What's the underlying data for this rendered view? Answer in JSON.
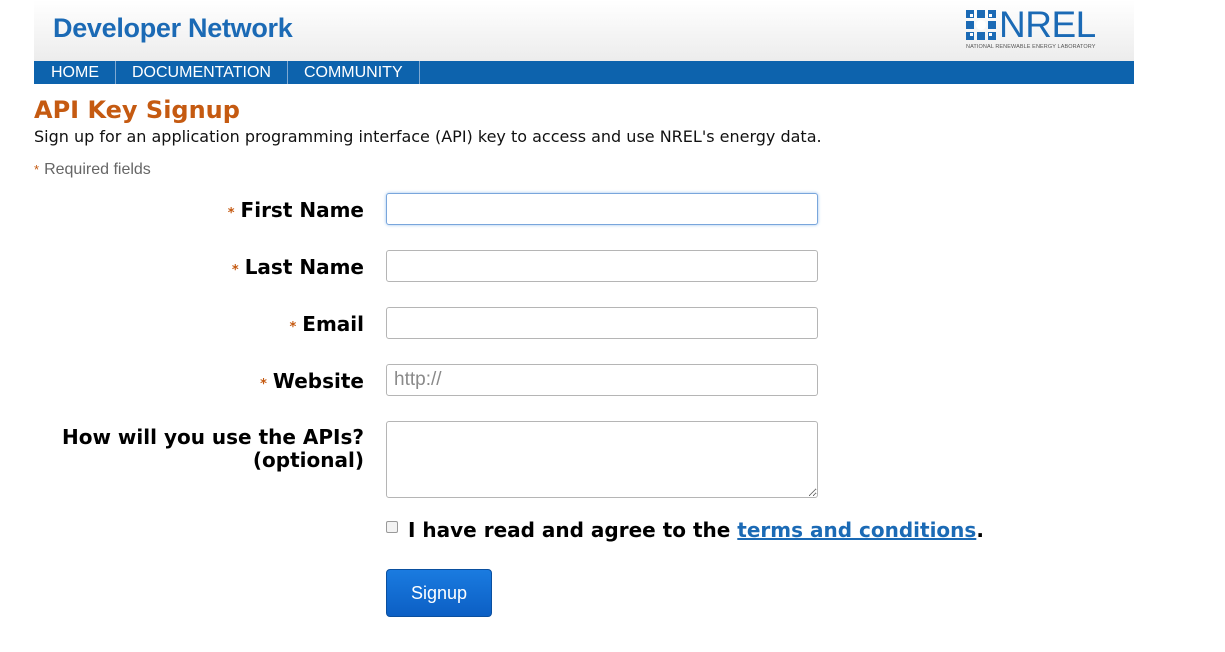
{
  "header": {
    "brand": "Developer Network",
    "logo_text": "NREL",
    "logo_subtext": "NATIONAL RENEWABLE ENERGY LABORATORY",
    "brand_color": "#1b6ab5"
  },
  "nav": {
    "items": [
      "HOME",
      "DOCUMENTATION",
      "COMMUNITY"
    ],
    "background": "#0d63ad"
  },
  "page": {
    "title": "API Key Signup",
    "intro": "Sign up for an application programming interface (API) key to access and use NREL's energy data.",
    "required_marker": "*",
    "required_note": "Required fields",
    "accent_color": "#c55a11"
  },
  "form": {
    "first_name_label": "First Name",
    "first_name_value": "",
    "last_name_label": "Last Name",
    "last_name_value": "",
    "email_label": "Email",
    "email_value": "",
    "website_label": "Website",
    "website_placeholder": "http://",
    "usage_label_line1": "How will you use the APIs?",
    "usage_label_line2": "(optional)",
    "usage_value": "",
    "agree_text": "I have read and agree to the",
    "terms_link": "terms and conditions",
    "agree_period": ".",
    "agree_checked": false,
    "submit_label": "Signup"
  }
}
